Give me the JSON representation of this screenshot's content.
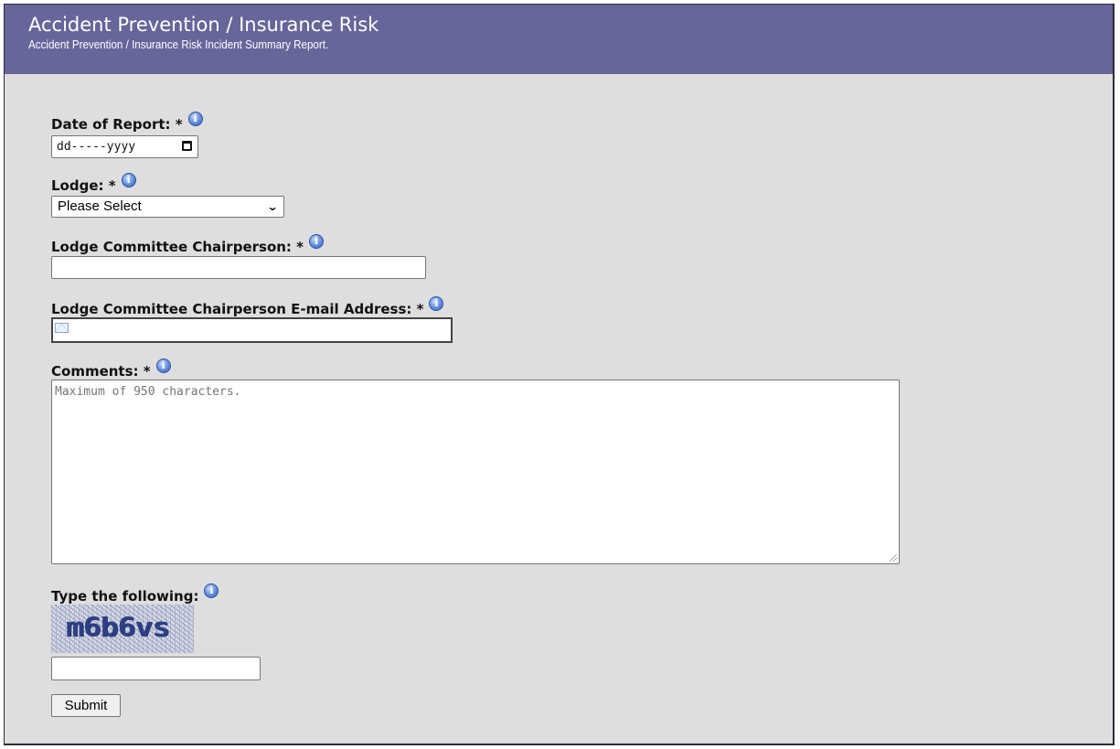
{
  "header": {
    "title": "Accident Prevention / Insurance Risk",
    "subtitle": "Accident Prevention / Insurance Risk Incident Summary Report."
  },
  "fields": {
    "date": {
      "label": "Date of Report:",
      "required_mark": "*",
      "value": "dd-----yyyy"
    },
    "lodge": {
      "label": "Lodge:",
      "required_mark": "*",
      "selected": "Please Select"
    },
    "chairperson": {
      "label": "Lodge Committee Chairperson:",
      "required_mark": "*",
      "value": ""
    },
    "email": {
      "label": "Lodge Committee Chairperson E-mail Address:",
      "required_mark": "*",
      "value": ""
    },
    "comments": {
      "label": "Comments:",
      "required_mark": "*",
      "placeholder": "Maximum of 950 characters."
    },
    "captcha": {
      "label": "Type the following:",
      "image_text": "m6b6vs",
      "value": ""
    }
  },
  "submit_label": "Submit",
  "icons": {
    "info": "info-icon",
    "calendar": "calendar-icon",
    "dropdown": "chevron-down-icon",
    "email": "envelope-icon"
  },
  "colors": {
    "header_bg": "#67669a",
    "page_bg": "#dedede",
    "info_icon": "#2f5fbf"
  }
}
